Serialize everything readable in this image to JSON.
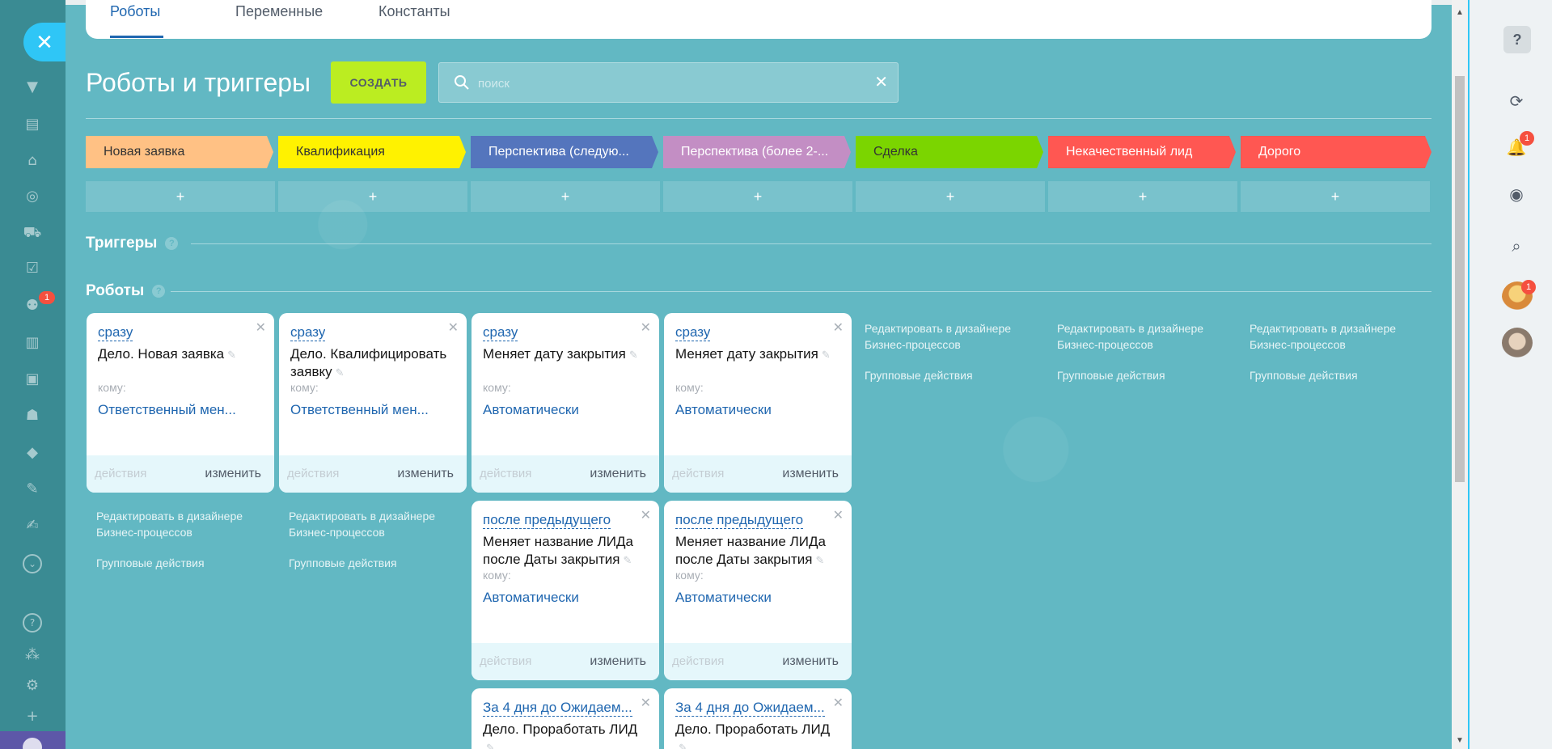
{
  "sidebar": {
    "close_icon": "✕",
    "notification_count": "1",
    "icons": [
      "filter-icon",
      "calendar-icon",
      "bank-icon",
      "target-icon",
      "cart-icon",
      "checkbox-icon",
      "people-icon",
      "chart-icon",
      "contact-card-icon",
      "robot-icon",
      "box-icon",
      "document-edit-icon",
      "signature-icon",
      "chevron-down-icon",
      "help-icon",
      "sitemap-icon",
      "gear-icon",
      "plus-icon"
    ]
  },
  "tabs": [
    {
      "label": "Роботы"
    },
    {
      "label": "Переменные"
    },
    {
      "label": "Константы"
    }
  ],
  "page": {
    "title": "Роботы и триггеры",
    "create_label": "СОЗДАТЬ",
    "search_placeholder": "поиск"
  },
  "stages": [
    {
      "label": "Новая заявка",
      "color": "#ffc184",
      "text_color": "#333333"
    },
    {
      "label": "Квалификация",
      "color": "#fff200",
      "text_color": "#333333"
    },
    {
      "label": "Перспектива (следую...",
      "color": "#5475bd",
      "text_color": "#ffffff"
    },
    {
      "label": "Перспектива (более 2-...",
      "color": "#c38ec4",
      "text_color": "#ffffff"
    },
    {
      "label": "Сделка",
      "color": "#7bd500",
      "text_color": "#333333"
    },
    {
      "label": "Некачественный лид",
      "color": "#ff5752",
      "text_color": "#ffffff"
    },
    {
      "label": "Дорого",
      "color": "#ff5752",
      "text_color": "#ffffff"
    }
  ],
  "sections": {
    "triggers": "Триггеры",
    "robots": "Роботы"
  },
  "robot_labels": {
    "to": "кому:",
    "actions": "действия",
    "edit": "изменить"
  },
  "robots": [
    {
      "delay": "сразу",
      "title": "Дело. Новая заявка",
      "to": "Ответственный мен..."
    },
    {
      "delay": "сразу",
      "title": "Дело. Квалифицировать заявку",
      "to": "Ответственный мен..."
    },
    {
      "delay": "сразу",
      "title": "Меняет дату закрытия",
      "to": "Автоматически"
    },
    {
      "delay": "сразу",
      "title": "Меняет дату закрытия",
      "to": "Автоматически"
    },
    {
      "delay": "после предыдущего",
      "title": "Меняет название ЛИДа после Даты закрытия",
      "to": "Автоматически"
    },
    {
      "delay": "после предыдущего",
      "title": "Меняет название ЛИДа после Даты закрытия",
      "to": "Автоматически"
    },
    {
      "delay": "За 4 дня до Ожидаем...",
      "title": "Дело. Проработать ЛИД"
    },
    {
      "delay": "За 4 дня до Ожидаем...",
      "title": "Дело. Проработать ЛИД"
    }
  ],
  "column_links": {
    "designer": "Редактировать в дизайнере Бизнес-процессов",
    "group": "Групповые действия"
  },
  "right_panel": {
    "help": "?",
    "notifications_count": "1",
    "avatar_count": "1",
    "icons": [
      "help-icon",
      "refresh-clock-icon",
      "bell-icon",
      "chat-icon",
      "search-icon"
    ]
  }
}
